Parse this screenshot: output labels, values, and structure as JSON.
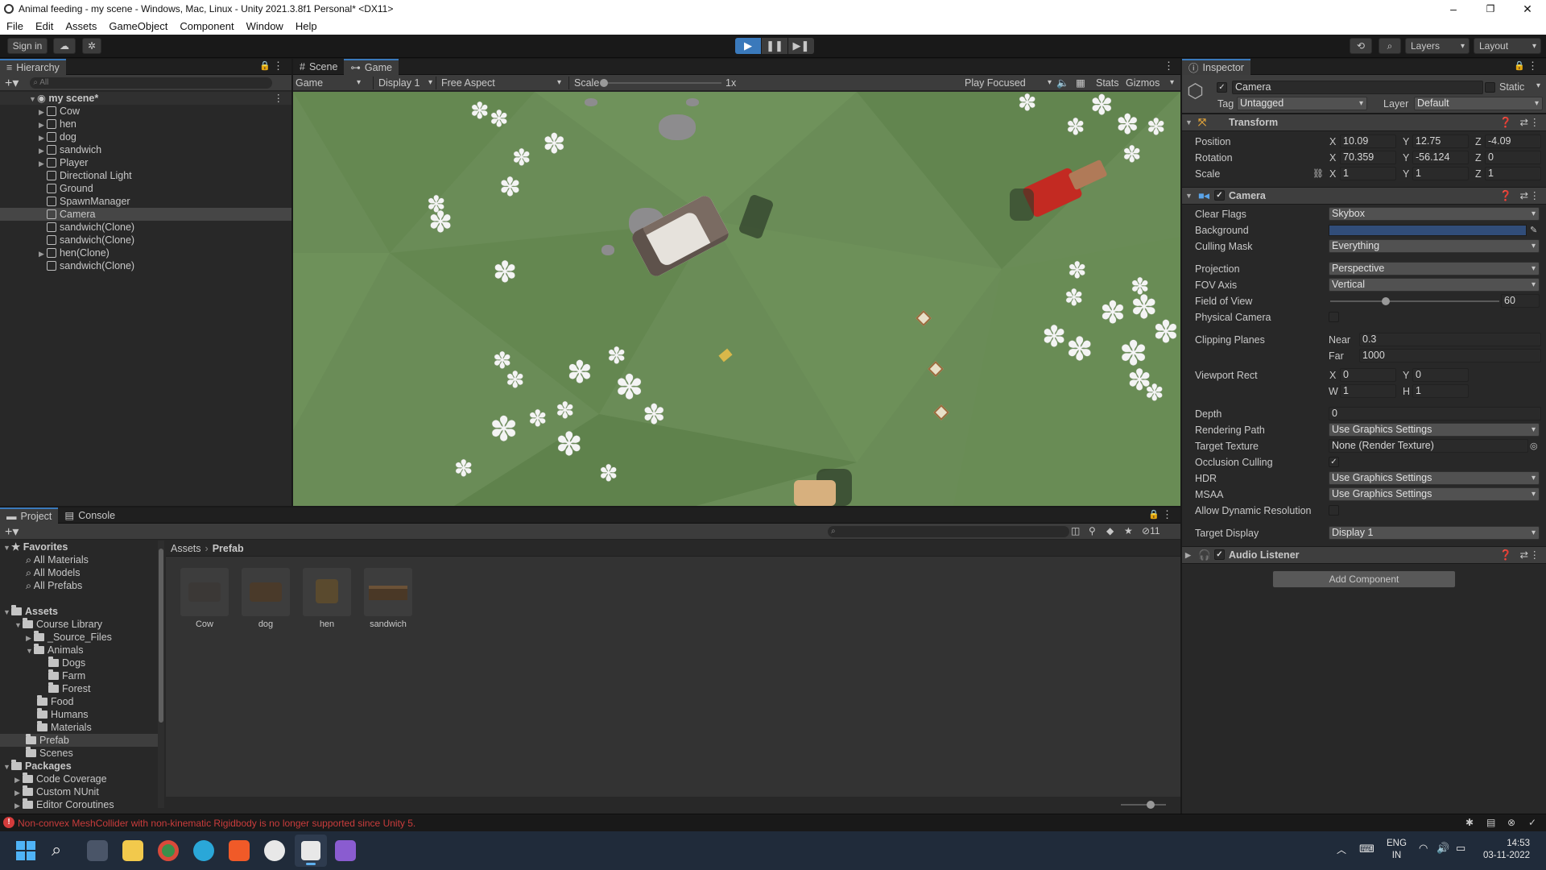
{
  "window": {
    "title": "Animal feeding - my scene - Windows, Mac, Linux - Unity 2021.3.8f1 Personal* <DX11>"
  },
  "menu": [
    "File",
    "Edit",
    "Assets",
    "GameObject",
    "Component",
    "Window",
    "Help"
  ],
  "toolbar": {
    "sign_in": "Sign in",
    "layers": "Layers",
    "layout": "Layout"
  },
  "hierarchy": {
    "tab": "Hierarchy",
    "search_placeholder": "All",
    "scene": "my scene*",
    "items": [
      "Cow",
      "hen",
      "dog",
      "sandwich",
      "Player",
      "Directional Light",
      "Ground",
      "SpawnManager",
      "Camera",
      "sandwich(Clone)",
      "sandwich(Clone)",
      "hen(Clone)",
      "sandwich(Clone)"
    ]
  },
  "view": {
    "tab_scene": "Scene",
    "tab_game": "Game",
    "game_dropdown": "Game",
    "display": "Display 1",
    "aspect": "Free Aspect",
    "scale_label": "Scale",
    "scale_value": "1x",
    "play_focused": "Play Focused",
    "stats": "Stats",
    "gizmos": "Gizmos"
  },
  "inspector": {
    "tab": "Inspector",
    "object_name": "Camera",
    "static_label": "Static",
    "tag_label": "Tag",
    "tag_value": "Untagged",
    "layer_label": "Layer",
    "layer_value": "Default",
    "transform": {
      "title": "Transform",
      "position_label": "Position",
      "rotation_label": "Rotation",
      "scale_label": "Scale",
      "position": {
        "x": "10.09",
        "y": "12.75",
        "z": "-4.09"
      },
      "rotation": {
        "x": "70.359",
        "y": "-56.124",
        "z": "0"
      },
      "scale": {
        "x": "1",
        "y": "1",
        "z": "1"
      }
    },
    "camera": {
      "title": "Camera",
      "clear_flags_label": "Clear Flags",
      "clear_flags": "Skybox",
      "background_label": "Background",
      "background_color": "#314d79",
      "culling_mask_label": "Culling Mask",
      "culling_mask": "Everything",
      "projection_label": "Projection",
      "projection": "Perspective",
      "fov_axis_label": "FOV Axis",
      "fov_axis": "Vertical",
      "fov_label": "Field of View",
      "fov": "60",
      "fov_fraction": 0.33,
      "physical_label": "Physical Camera",
      "clipping_label": "Clipping Planes",
      "near_label": "Near",
      "near": "0.3",
      "far_label": "Far",
      "far": "1000",
      "viewport_label": "Viewport Rect",
      "vx": "0",
      "vy": "0",
      "vw": "1",
      "vh": "1",
      "depth_label": "Depth",
      "depth": "0",
      "rendering_path_label": "Rendering Path",
      "rendering_path": "Use Graphics Settings",
      "target_texture_label": "Target Texture",
      "target_texture": "None (Render Texture)",
      "occlusion_label": "Occlusion Culling",
      "hdr_label": "HDR",
      "hdr": "Use Graphics Settings",
      "msaa_label": "MSAA",
      "msaa": "Use Graphics Settings",
      "dyn_res_label": "Allow Dynamic Resolution",
      "target_display_label": "Target Display",
      "target_display": "Display 1"
    },
    "audio_listener": {
      "title": "Audio Listener"
    },
    "add_component": "Add Component"
  },
  "project": {
    "tab_project": "Project",
    "tab_console": "Console",
    "favorites": "Favorites",
    "fav_items": [
      "All Materials",
      "All Models",
      "All Prefabs"
    ],
    "assets": "Assets",
    "course_library": "Course Library",
    "source_files": "_Source_Files",
    "animals": "Animals",
    "dogs": "Dogs",
    "farm": "Farm",
    "forest": "Forest",
    "food": "Food",
    "humans": "Humans",
    "materials": "Materials",
    "prefab": "Prefab",
    "scenes": "Scenes",
    "packages": "Packages",
    "pkg_items": [
      "Code Coverage",
      "Custom NUnit",
      "Editor Coroutines"
    ],
    "breadcrumb_root": "Assets",
    "breadcrumb_current": "Prefab",
    "hidden_count": "11",
    "assets_grid": [
      "Cow",
      "dog",
      "hen",
      "sandwich"
    ]
  },
  "status": {
    "error": "Non-convex MeshCollider with non-kinematic Rigidbody is no longer supported since Unity 5."
  },
  "taskbar": {
    "lang1": "ENG",
    "lang2": "IN",
    "time": "14:53",
    "date": "03-11-2022"
  }
}
